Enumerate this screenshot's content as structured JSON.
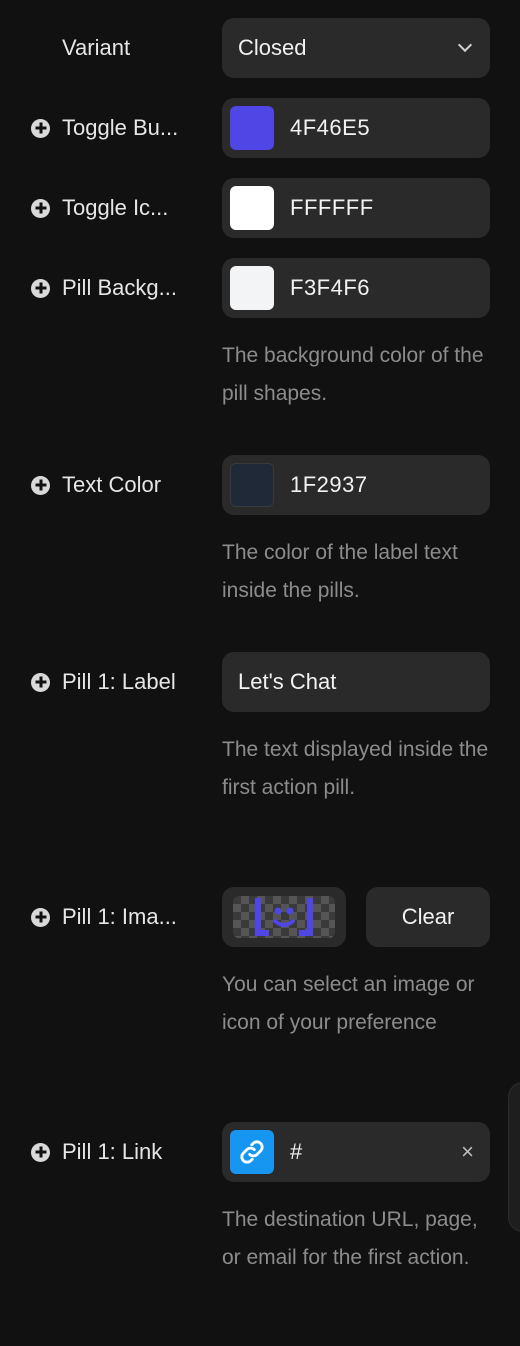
{
  "fields": {
    "variant": {
      "label": "Variant",
      "value": "Closed"
    },
    "toggle_button": {
      "label": "Toggle Bu...",
      "hex": "4F46E5",
      "color": "#4F46E5"
    },
    "toggle_icon": {
      "label": "Toggle Ic...",
      "hex": "FFFFFF",
      "color": "#FFFFFF"
    },
    "pill_background": {
      "label": "Pill Backg...",
      "hex": "F3F4F6",
      "color": "#F3F4F6",
      "description": "The background color of the pill shapes."
    },
    "text_color": {
      "label": "Text Color",
      "hex": "1F2937",
      "color": "#1F2937",
      "description": "The color of the label text inside the pills."
    },
    "pill1_label": {
      "label": "Pill 1: Label",
      "value": "Let's Chat",
      "description": "The text displayed inside the first action pill."
    },
    "pill1_image": {
      "label": "Pill 1: Ima...",
      "clear_label": "Clear",
      "description": "You can select an image or icon of your preference",
      "icon": "smiley-icon"
    },
    "pill1_link": {
      "label": "Pill 1: Link",
      "value": "#",
      "description": "The destination URL, page, or email for the first action.",
      "icon": "link-icon",
      "clear_icon": "×"
    }
  }
}
